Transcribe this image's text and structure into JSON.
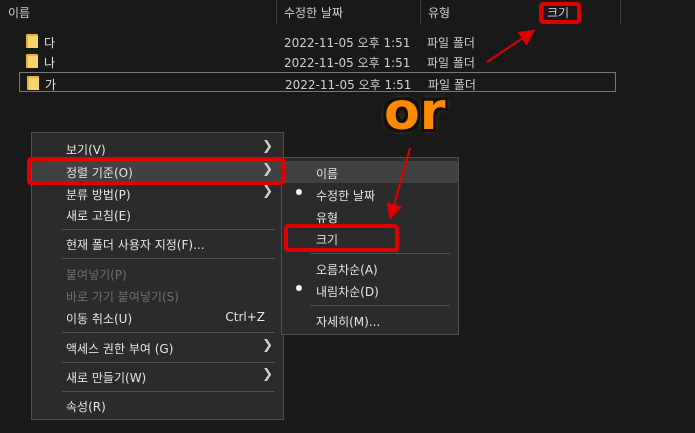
{
  "columns": {
    "name": "이름",
    "date": "수정한 날짜",
    "type": "유형",
    "size": "크기"
  },
  "files": [
    {
      "name": "다",
      "date": "2022-11-05 오후 1:51",
      "type": "파일 폴더"
    },
    {
      "name": "나",
      "date": "2022-11-05 오후 1:51",
      "type": "파일 폴더"
    },
    {
      "name": "가",
      "date": "2022-11-05 오후 1:51",
      "type": "파일 폴더"
    }
  ],
  "context_menu": {
    "view": "보기(V)",
    "sort_by": "정렬 기준(O)",
    "group_by": "분류 방법(P)",
    "refresh": "새로 고침(E)",
    "customize": "현재 폴더 사용자 지정(F)...",
    "paste": "붙여넣기(P)",
    "paste_shortcut": "바로 가기 붙여넣기(S)",
    "undo_move": "이동 취소(U)",
    "undo_shortcut": "Ctrl+Z",
    "give_access": "액세스 권한 부여 (G)",
    "new": "새로 만들기(W)",
    "properties": "속성(R)"
  },
  "sort_submenu": {
    "name": "이름",
    "date": "수정한 날짜",
    "type": "유형",
    "size": "크기",
    "ascending": "오름차순(A)",
    "descending": "내림차순(D)",
    "more": "자세히(M)..."
  },
  "annotation": {
    "text": "or",
    "color": "#e00000"
  }
}
